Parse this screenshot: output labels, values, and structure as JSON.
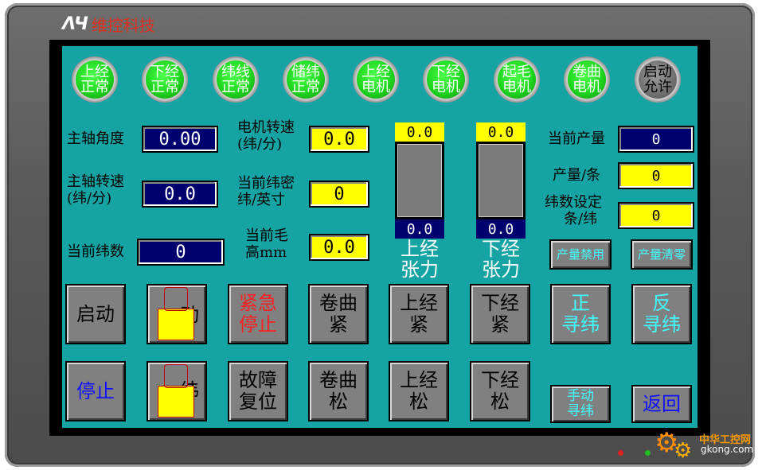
{
  "brand": {
    "logo": "ΛЧ",
    "name": "维控科技"
  },
  "indicators": [
    {
      "line1": "上经",
      "line2": "正常",
      "state": "on"
    },
    {
      "line1": "下经",
      "line2": "正常",
      "state": "on"
    },
    {
      "line1": "纬线",
      "line2": "正常",
      "state": "on"
    },
    {
      "line1": "储纬",
      "line2": "正常",
      "state": "on"
    },
    {
      "line1": "上经",
      "line2": "电机",
      "state": "on"
    },
    {
      "line1": "下经",
      "line2": "电机",
      "state": "on"
    },
    {
      "line1": "起毛",
      "line2": "电机",
      "state": "on"
    },
    {
      "line1": "卷曲",
      "line2": "电机",
      "state": "on"
    },
    {
      "line1": "启动",
      "line2": "允许",
      "state": "off"
    }
  ],
  "params": {
    "spindle_angle": {
      "label": "主轴角度",
      "value": "0.00"
    },
    "spindle_speed": {
      "label1": "主轴转速",
      "label2": "(纬/分)",
      "value": "0.0"
    },
    "weft_count": {
      "label": "当前纬数",
      "value": "0"
    },
    "motor_speed": {
      "label1": "电机转速",
      "label2": "(纬/分)",
      "value": "0.0"
    },
    "weft_density": {
      "label1": "当前纬密",
      "label2": "纬/英寸",
      "value": "0"
    },
    "pile_height": {
      "label1": "当前毛",
      "label2": "高mm",
      "value": "0.0"
    },
    "output": {
      "label": "当前产量",
      "value": "0"
    },
    "output_per": {
      "label": "产量/条",
      "value": "0"
    },
    "weft_set": {
      "label1": "纬数设定",
      "label2": "条/纬",
      "value": "0"
    }
  },
  "tension": {
    "upper": {
      "top": "0.0",
      "bottom": "0.0",
      "line1": "上经",
      "line2": "张力"
    },
    "lower": {
      "top": "0.0",
      "bottom": "0.0",
      "line1": "下经",
      "line2": "张力"
    }
  },
  "buttons": {
    "output_disable": "产量禁用",
    "output_clear": "产量清零",
    "start": "启动",
    "estop": {
      "line1": "紧急",
      "line2": "停止"
    },
    "curl_tight": {
      "line1": "卷曲",
      "line2": "紧"
    },
    "upper_tight": {
      "line1": "上经",
      "line2": "紧"
    },
    "lower_tight": {
      "line1": "下经",
      "line2": "紧"
    },
    "fwd_seek": {
      "line1": "正",
      "line2": "寻纬"
    },
    "rev_seek": {
      "line1": "反",
      "line2": "寻纬"
    },
    "stop": "停止",
    "fault_reset": {
      "line1": "故障",
      "line2": "复位"
    },
    "curl_loose": {
      "line1": "卷曲",
      "line2": "松"
    },
    "upper_loose": {
      "line1": "上经",
      "line2": "松"
    },
    "lower_loose": {
      "line1": "下经",
      "line2": "松"
    },
    "manual_seek": {
      "line1": "手动",
      "line2": "寻纬"
    },
    "back": "返回",
    "jog_partial": "动",
    "weft_partial": "纬"
  },
  "colors": {
    "screen": "#16a3a3",
    "lamp_on": "#1fd61f",
    "field_blue": "#00006e",
    "field_yellow": "#ffff00"
  },
  "watermark": {
    "line1": "中华工控网",
    "line2": "gkong.com"
  }
}
